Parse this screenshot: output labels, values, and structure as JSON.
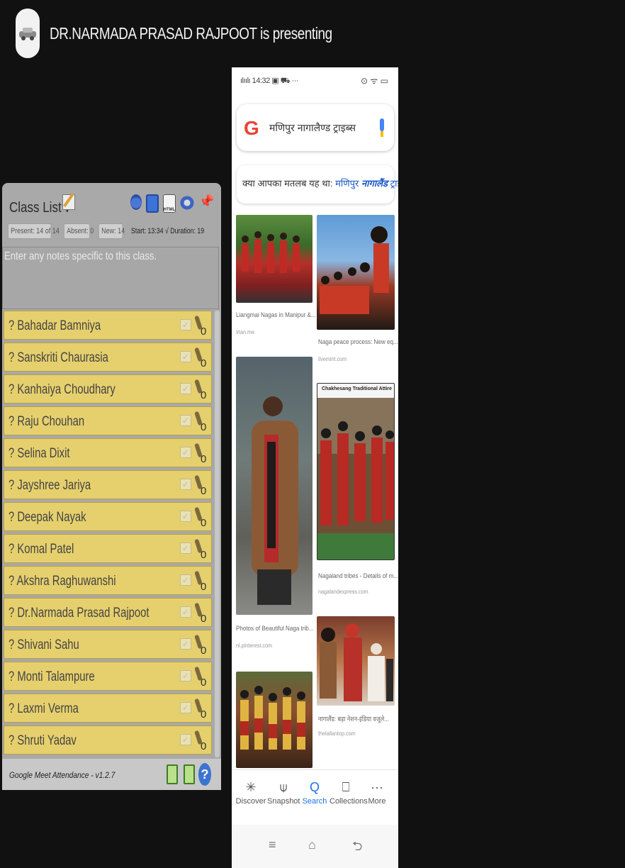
{
  "presenter": {
    "text": "DR.NARMADA PRASAD RAJPOOT is presenting",
    "avatar_icon": "car-avatar-icon"
  },
  "class_list": {
    "title": "Class List",
    "caret": "∨",
    "stats": {
      "present": "Present: 14 of 14",
      "absent": "Absent: 0",
      "new": "New: 14",
      "start": "Start: 13:34",
      "duration": "√ Duration: 19"
    },
    "notes_placeholder": "Enter any notes specific to this class.",
    "students": [
      "? Bahadar Bamniya",
      "? Sanskriti Chaurasia",
      "? Kanhaiya Choudhary",
      "? Raju Chouhan",
      "? Selina Dixit",
      "? Jayshree Jariya",
      "? Deepak Nayak",
      "? Komal Patel",
      "? Akshra Raghuwanshi",
      "? Dr.Narmada Prasad Rajpoot",
      "? Shivani Sahu",
      "? Monti Talampure",
      "? Laxmi Verma",
      "? Shruti Yadav"
    ],
    "footer": "Google Meet Attendance - v1.2.7",
    "help": "?"
  },
  "phone": {
    "status_left": "ılıılı 14:32 ▣ ⛟ ···",
    "status_right": "⊙ ᯤ ▭",
    "search_query": "मणिपुर नागालैण्ड ट्राइब्स",
    "suggest_prefix": "क्या आपका मतलब यह था: ",
    "suggest_link_a": "मणिपुर ",
    "suggest_link_b": "नागालैंड",
    "suggest_link_c": " ट्राइब्स",
    "results": [
      {
        "caption": "Liangmai Nagas in Manipur &...",
        "source": "lrtan.me"
      },
      {
        "caption": "Naga peace process: New eq...",
        "source": "livemint.com"
      },
      {
        "caption": "Photos of Beautiful Naga trib...",
        "source": "nl.pinterest.com"
      },
      {
        "caption": "Nagaland tribes - Details of m...",
        "source": "nagalandexpress.com"
      },
      {
        "caption": "नागालैंड: बड़ा नेशन-इंडिया वजूले...",
        "source": "thelallantop.com"
      }
    ],
    "image_banner": "Chakhesang Traditional Attire",
    "nav": [
      {
        "label": "Discover",
        "icon": "✳"
      },
      {
        "label": "Snapshot",
        "icon": "⍦"
      },
      {
        "label": "Search",
        "icon": "Q"
      },
      {
        "label": "Collections",
        "icon": "⎕"
      },
      {
        "label": "More",
        "icon": "···"
      }
    ],
    "sysnav": {
      "menu": "≡",
      "home": "⌂",
      "back": "⮌"
    }
  },
  "colors": {
    "student_row": "#e6d06d",
    "panel": "#a9a9a9",
    "accent_blue": "#1a73e8"
  }
}
